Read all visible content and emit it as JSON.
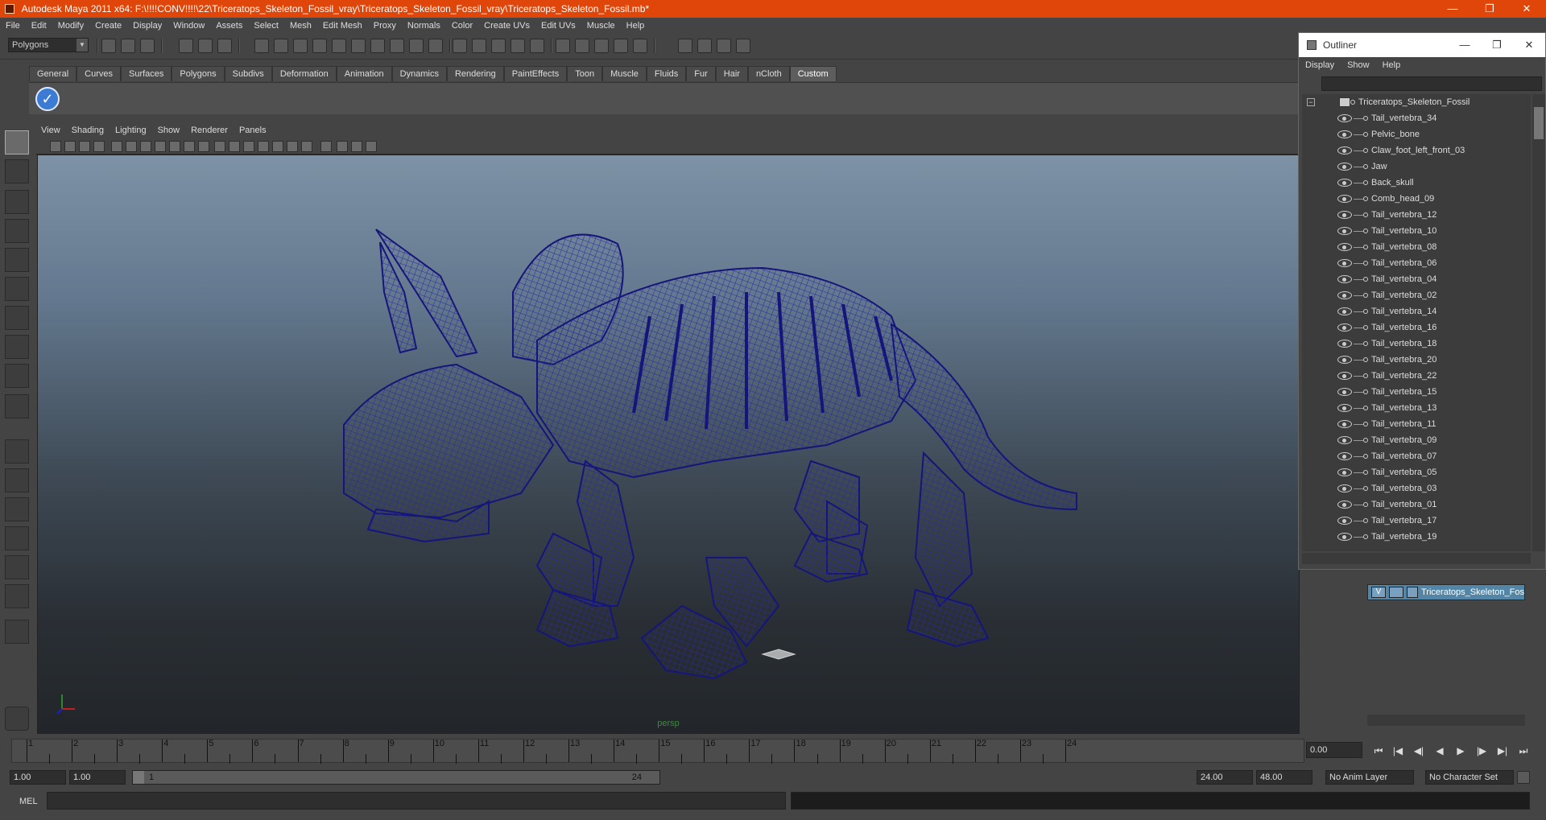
{
  "window": {
    "title": "Autodesk Maya 2011 x64: F:\\!!!!CONV!!!!\\22\\Triceratops_Skeleton_Fossil_vray\\Triceratops_Skeleton_Fossil_vray\\Triceratops_Skeleton_Fossil.mb*",
    "minimize": "—",
    "maximize": "❐",
    "close": "✕"
  },
  "menubar": [
    "File",
    "Edit",
    "Modify",
    "Create",
    "Display",
    "Window",
    "Assets",
    "Select",
    "Mesh",
    "Edit Mesh",
    "Proxy",
    "Normals",
    "Color",
    "Create UVs",
    "Edit UVs",
    "Muscle",
    "Help"
  ],
  "toolbar": {
    "mode": "Polygons"
  },
  "shelf": {
    "tabs": [
      "General",
      "Curves",
      "Surfaces",
      "Polygons",
      "Subdivs",
      "Deformation",
      "Animation",
      "Dynamics",
      "Rendering",
      "PaintEffects",
      "Toon",
      "Muscle",
      "Fluids",
      "Fur",
      "Hair",
      "nCloth",
      "Custom"
    ],
    "active": "Custom"
  },
  "panel": {
    "menu": [
      "View",
      "Shading",
      "Lighting",
      "Show",
      "Renderer",
      "Panels"
    ],
    "camera": "persp"
  },
  "timeline": {
    "ticks": [
      "1",
      "2",
      "3",
      "4",
      "5",
      "6",
      "7",
      "8",
      "9",
      "10",
      "11",
      "12",
      "13",
      "14",
      "15",
      "16",
      "17",
      "18",
      "19",
      "20",
      "21",
      "22",
      "23",
      "24"
    ],
    "current_frame": "0.00"
  },
  "range": {
    "start": "1.00",
    "start2": "1.00",
    "slider_start": "1",
    "slider_end": "24",
    "end": "24.00",
    "end2": "48.00",
    "anim_layer": "No Anim Layer",
    "character_set": "No Character Set"
  },
  "cmd": {
    "label": "MEL"
  },
  "outliner": {
    "title": "Outliner",
    "menu": [
      "Display",
      "Show",
      "Help"
    ],
    "root": "Triceratops_Skeleton_Fossil",
    "items": [
      "Tail_vertebra_34",
      "Pelvic_bone",
      "Claw_foot_left_front_03",
      "Jaw",
      "Back_skull",
      "Comb_head_09",
      "Tail_vertebra_12",
      "Tail_vertebra_10",
      "Tail_vertebra_08",
      "Tail_vertebra_06",
      "Tail_vertebra_04",
      "Tail_vertebra_02",
      "Tail_vertebra_14",
      "Tail_vertebra_16",
      "Tail_vertebra_18",
      "Tail_vertebra_20",
      "Tail_vertebra_22",
      "Tail_vertebra_15",
      "Tail_vertebra_13",
      "Tail_vertebra_11",
      "Tail_vertebra_09",
      "Tail_vertebra_07",
      "Tail_vertebra_05",
      "Tail_vertebra_03",
      "Tail_vertebra_01",
      "Tail_vertebra_17",
      "Tail_vertebra_19"
    ]
  },
  "layers": {
    "visible": "V",
    "name": "Triceratops_Skeleton_Fossil"
  },
  "colors": {
    "titlebar": "#e0460a",
    "wireframe": "#1a1a7a",
    "layer": "#5285a6"
  }
}
